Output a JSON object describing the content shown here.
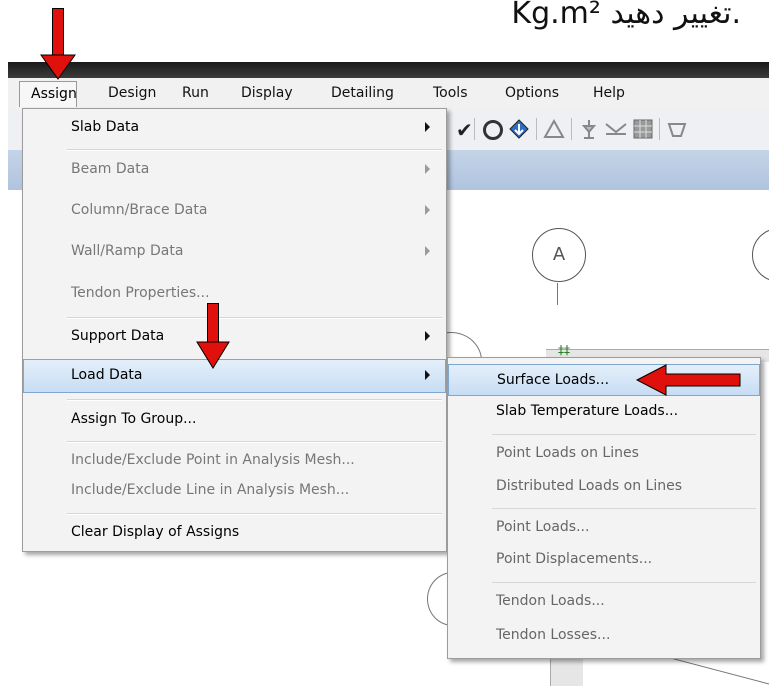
{
  "caption": {
    "text": "Kg.m² تغییر دهید."
  },
  "menubar": {
    "items": [
      "Assign",
      "Design",
      "Run",
      "Display",
      "Detailing",
      "Tools",
      "Options",
      "Help"
    ]
  },
  "toolbar": {
    "icons": [
      "checkmark-icon",
      "circle-icon",
      "drop-load-icon",
      "triangle-icon",
      "spring-icon",
      "support-icon",
      "mesh-icon",
      "cup-icon"
    ]
  },
  "grid": {
    "bubble_a": "A"
  },
  "assign_menu": {
    "items": [
      {
        "label": "Slab Data",
        "enabled": true,
        "submenu": true
      },
      {
        "label": "Beam Data",
        "enabled": false,
        "submenu": true
      },
      {
        "label": "Column/Brace Data",
        "enabled": false,
        "submenu": true
      },
      {
        "label": "Wall/Ramp Data",
        "enabled": false,
        "submenu": true
      },
      {
        "label": "Tendon Properties...",
        "enabled": false,
        "submenu": false
      },
      {
        "label": "Support Data",
        "enabled": true,
        "submenu": true
      },
      {
        "label": "Load Data",
        "enabled": true,
        "submenu": true,
        "highlighted": true
      },
      {
        "label": "Assign To Group...",
        "enabled": true,
        "submenu": false
      },
      {
        "label": "Include/Exclude Point in Analysis Mesh...",
        "enabled": false,
        "submenu": false
      },
      {
        "label": "Include/Exclude Line in Analysis Mesh...",
        "enabled": false,
        "submenu": false
      },
      {
        "label": "Clear Display of Assigns",
        "enabled": true,
        "submenu": false
      }
    ]
  },
  "load_data_submenu": {
    "items": [
      {
        "label": "Surface Loads...",
        "enabled": true,
        "highlighted": true
      },
      {
        "label": "Slab Temperature Loads...",
        "enabled": true
      },
      {
        "label": "Point Loads on Lines",
        "enabled": false
      },
      {
        "label": "Distributed Loads on Lines",
        "enabled": false
      },
      {
        "label": "Point Loads...",
        "enabled": false
      },
      {
        "label": "Point Displacements...",
        "enabled": false
      },
      {
        "label": "Tendon Loads...",
        "enabled": false
      },
      {
        "label": "Tendon Losses...",
        "enabled": false
      }
    ]
  },
  "colors": {
    "highlight_border": "#7fa6cf",
    "annotation_arrow": "#e0100c",
    "canvas_header": "#b0c4de"
  }
}
